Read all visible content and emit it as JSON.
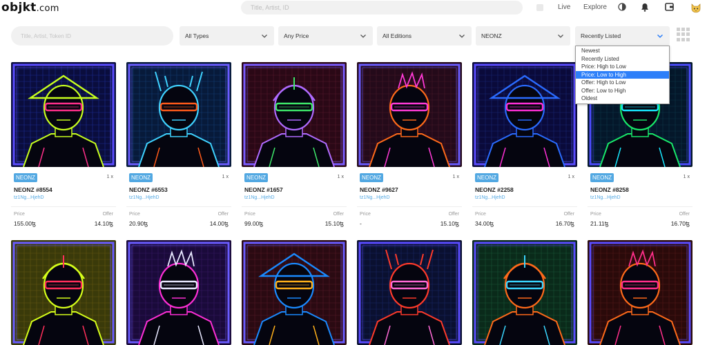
{
  "header": {
    "logo_main": "objkt",
    "logo_domain": ".com",
    "search_placeholder": "Title, Artist, ID",
    "nav": [
      "Live",
      "Explore"
    ],
    "icons": [
      "theme-toggle-icon",
      "bell-icon",
      "wallet-icon",
      "avatar-icon"
    ]
  },
  "filters": {
    "search_placeholder": "Title, Artist, Token ID",
    "type": "All Types",
    "price": "Any Price",
    "editions": "All Editions",
    "collection": "NEONZ",
    "sort": "Recently Listed",
    "sort_options": [
      "Newest",
      "Recently Listed",
      "Price: High to Low",
      "Price: Low to High",
      "Offer: High to Low",
      "Offer: Low to High",
      "Oldest"
    ],
    "sort_highlighted": "Price: Low to High"
  },
  "labels": {
    "price": "Price",
    "offer": "Offer"
  },
  "colors": {
    "accent": "#52a8e2",
    "highlight": "#2d7ff9",
    "field_bg": "#f1f1f1"
  },
  "cards": [
    {
      "collection": "NEONZ",
      "editions": "1 x",
      "name": "NEONZ #8554",
      "owner": "tz1Ng...HjehD",
      "price": "155.00ꜩ",
      "offer": "14.10ꜩ"
    },
    {
      "collection": "NEONZ",
      "editions": "1 x",
      "name": "NEONZ #6553",
      "owner": "tz1Ng...HjehD",
      "price": "20.90ꜩ",
      "offer": "14.00ꜩ"
    },
    {
      "collection": "NEONZ",
      "editions": "1 x",
      "name": "NEONZ #1657",
      "owner": "tz1Ng...HjehD",
      "price": "99.00ꜩ",
      "offer": "15.10ꜩ"
    },
    {
      "collection": "NEONZ",
      "editions": "1 x",
      "name": "NEONZ #9627",
      "owner": "tz1Ng...HjehD",
      "price": "-",
      "offer": "15.10ꜩ"
    },
    {
      "collection": "NEONZ",
      "editions": "1 x",
      "name": "NEONZ #2258",
      "owner": "tz1Ng...HjehD",
      "price": "34.00ꜩ",
      "offer": "16.70ꜩ"
    },
    {
      "collection": "NEONZ",
      "editions": "1 x",
      "name": "NEONZ #8258",
      "owner": "tz1Ng...HjehD",
      "price": "21.11ꜩ",
      "offer": "16.70ꜩ"
    }
  ],
  "artworks": [
    {
      "bg": "#0a0d3d",
      "grid": "#1f2f9a",
      "frame": "#5a4cff",
      "main": "#c8ff1e",
      "accent": "#ff2f8a"
    },
    {
      "bg": "#071a3a",
      "grid": "#17407a",
      "frame": "#6a5cff",
      "main": "#3fd2ff",
      "accent": "#ff5a1a"
    },
    {
      "bg": "#2a0816",
      "grid": "#5a1a2e",
      "frame": "#7a5cff",
      "main": "#b06bff",
      "accent": "#3ee86a"
    },
    {
      "bg": "#240a1a",
      "grid": "#4a1a2a",
      "frame": "#6a5cff",
      "main": "#ff6a1a",
      "accent": "#ff3ad6"
    },
    {
      "bg": "#0a0a3a",
      "grid": "#1a2a7a",
      "frame": "#5a4cff",
      "main": "#2a6bff",
      "accent": "#ff2fd6"
    },
    {
      "bg": "#04172a",
      "grid": "#0d3a4a",
      "frame": "#4c4cff",
      "main": "#18e86a",
      "accent": "#18e8ff"
    },
    {
      "bg": "#3a3a0a",
      "grid": "#6a5a12",
      "frame": "#6a5cff",
      "main": "#d6ff1a",
      "accent": "#ff2f5a"
    },
    {
      "bg": "#1a0a3a",
      "grid": "#3a1a6a",
      "frame": "#6a5cff",
      "main": "#ff2fd6",
      "accent": "#e8e8ff"
    },
    {
      "bg": "#2a0a12",
      "grid": "#5a1a2a",
      "frame": "#6a5cff",
      "main": "#1a8aff",
      "accent": "#ffb01a"
    },
    {
      "bg": "#0a1030",
      "grid": "#1a2a6a",
      "frame": "#5a4cff",
      "main": "#ff3a2a",
      "accent": "#ff6ad6"
    },
    {
      "bg": "#0a2a1a",
      "grid": "#1a5a3a",
      "frame": "#5a4cff",
      "main": "#ff6a1a",
      "accent": "#3ad6ff"
    },
    {
      "bg": "#2a0a0a",
      "grid": "#5a1a1a",
      "frame": "#5a4cff",
      "main": "#ff6a1a",
      "accent": "#ff2f8a"
    }
  ]
}
